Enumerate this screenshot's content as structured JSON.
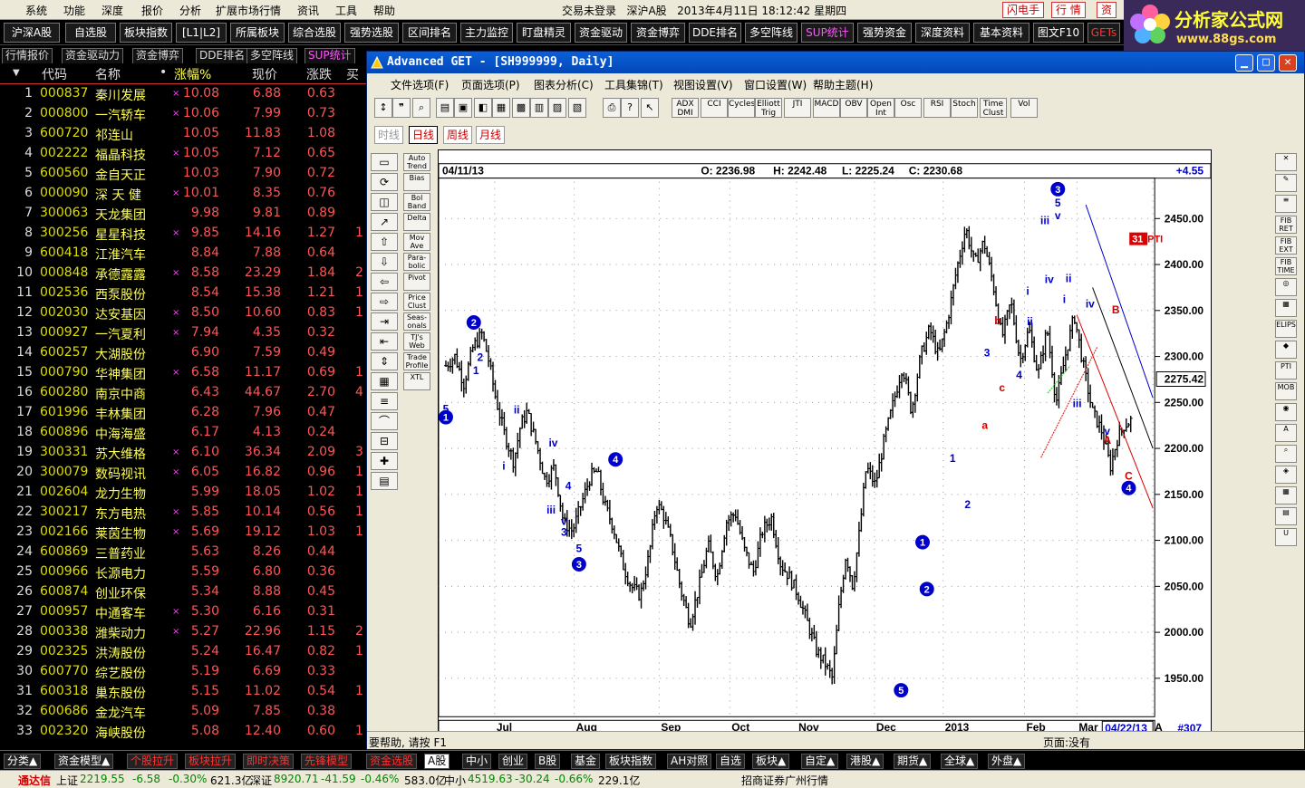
{
  "menu": [
    "系统",
    "功能",
    "深度",
    "报价",
    "分析",
    "扩展市场行情",
    "资讯",
    "工具",
    "帮助"
  ],
  "topstatus": {
    "login": "交易未登录",
    "market": "深沪A股",
    "datetime": "2013年4月11日 18:12:42 星期四"
  },
  "topbuttons": [
    "闪电手",
    "行 情",
    "资"
  ],
  "logo": {
    "title": "分析家公式网",
    "url": "www.88gs.com"
  },
  "toolbar2": [
    "沪深A股",
    "自选股",
    "板块指数",
    "[L1|L2]",
    "所属板块",
    "综合选股",
    "强势选股",
    "区间排名",
    "主力监控",
    "盯盘精灵",
    "资金驱动",
    "资金博弈",
    "DDE排名",
    "多空阵线",
    "SUP统计",
    "强势资金",
    "深度资料",
    "基本资料",
    "图文F10",
    "GETs"
  ],
  "tabs3": [
    "行情报价",
    "资金驱动力",
    "资金博弈",
    "DDE排名",
    "多空阵线",
    "SUP统计"
  ],
  "list": {
    "headers": [
      "代码",
      "名称",
      "•",
      "涨幅%",
      "现价",
      "涨跌",
      "买"
    ],
    "rows": [
      [
        "1",
        "000837",
        "秦川发展",
        "×",
        "10.08",
        "6.88",
        "0.63",
        ""
      ],
      [
        "2",
        "000800",
        "一汽轿车",
        "×",
        "10.06",
        "7.99",
        "0.73",
        ""
      ],
      [
        "3",
        "600720",
        "祁连山",
        "",
        "10.05",
        "11.83",
        "1.08",
        ""
      ],
      [
        "4",
        "002222",
        "福晶科技",
        "×",
        "10.05",
        "7.12",
        "0.65",
        ""
      ],
      [
        "5",
        "600560",
        "金自天正",
        "",
        "10.03",
        "7.90",
        "0.72",
        ""
      ],
      [
        "6",
        "000090",
        "深 天 健",
        "×",
        "10.01",
        "8.35",
        "0.76",
        ""
      ],
      [
        "7",
        "300063",
        "天龙集团",
        "",
        "9.98",
        "9.81",
        "0.89",
        ""
      ],
      [
        "8",
        "300256",
        "星星科技",
        "×",
        "9.85",
        "14.16",
        "1.27",
        "1"
      ],
      [
        "9",
        "600418",
        "江淮汽车",
        "",
        "8.84",
        "7.88",
        "0.64",
        ""
      ],
      [
        "10",
        "000848",
        "承德露露",
        "×",
        "8.58",
        "23.29",
        "1.84",
        "2"
      ],
      [
        "11",
        "002536",
        "西泵股份",
        "",
        "8.54",
        "15.38",
        "1.21",
        "1"
      ],
      [
        "12",
        "002030",
        "达安基因",
        "×",
        "8.50",
        "10.60",
        "0.83",
        "1"
      ],
      [
        "13",
        "000927",
        "一汽夏利",
        "×",
        "7.94",
        "4.35",
        "0.32",
        ""
      ],
      [
        "14",
        "600257",
        "大湖股份",
        "",
        "6.90",
        "7.59",
        "0.49",
        ""
      ],
      [
        "15",
        "000790",
        "华神集团",
        "×",
        "6.58",
        "11.17",
        "0.69",
        "1"
      ],
      [
        "16",
        "600280",
        "南京中商",
        "",
        "6.43",
        "44.67",
        "2.70",
        "4"
      ],
      [
        "17",
        "601996",
        "丰林集团",
        "",
        "6.28",
        "7.96",
        "0.47",
        ""
      ],
      [
        "18",
        "600896",
        "中海海盛",
        "",
        "6.17",
        "4.13",
        "0.24",
        ""
      ],
      [
        "19",
        "300331",
        "苏大维格",
        "×",
        "6.10",
        "36.34",
        "2.09",
        "3"
      ],
      [
        "20",
        "300079",
        "数码视讯",
        "×",
        "6.05",
        "16.82",
        "0.96",
        "1"
      ],
      [
        "21",
        "002604",
        "龙力生物",
        "",
        "5.99",
        "18.05",
        "1.02",
        "1"
      ],
      [
        "22",
        "300217",
        "东方电热",
        "×",
        "5.85",
        "10.14",
        "0.56",
        "1"
      ],
      [
        "23",
        "002166",
        "莱茵生物",
        "×",
        "5.69",
        "19.12",
        "1.03",
        "1"
      ],
      [
        "24",
        "600869",
        "三普药业",
        "",
        "5.63",
        "8.26",
        "0.44",
        ""
      ],
      [
        "25",
        "000966",
        "长源电力",
        "",
        "5.59",
        "6.80",
        "0.36",
        ""
      ],
      [
        "26",
        "600874",
        "创业环保",
        "",
        "5.34",
        "8.88",
        "0.45",
        ""
      ],
      [
        "27",
        "000957",
        "中通客车",
        "×",
        "5.30",
        "6.16",
        "0.31",
        ""
      ],
      [
        "28",
        "000338",
        "潍柴动力",
        "×",
        "5.27",
        "22.96",
        "1.15",
        "2"
      ],
      [
        "29",
        "002325",
        "洪涛股份",
        "",
        "5.24",
        "16.47",
        "0.82",
        "1"
      ],
      [
        "30",
        "600770",
        "综艺股份",
        "",
        "5.19",
        "6.69",
        "0.33",
        ""
      ],
      [
        "31",
        "600318",
        "巢东股份",
        "",
        "5.15",
        "11.02",
        "0.54",
        "1"
      ],
      [
        "32",
        "600686",
        "金龙汽车",
        "",
        "5.09",
        "7.85",
        "0.38",
        ""
      ],
      [
        "33",
        "002320",
        "海峡股份",
        "",
        "5.08",
        "12.40",
        "0.60",
        "1"
      ]
    ]
  },
  "window": {
    "title": "Advanced GET - [SH999999, Daily]",
    "menu": [
      "文件选项(F)",
      "页面选项(P)",
      "图表分析(C)",
      "工具集锦(T)",
      "视图设置(V)",
      "窗口设置(W)",
      "帮助主题(H)"
    ],
    "tools": [
      "ADX DMI",
      "CCI",
      "Cycles",
      "Elliott Trig",
      "JTI",
      "MACD",
      "OBV",
      "Open Int",
      "Osc",
      "RSI",
      "Stoch",
      "Time Clust",
      "Vol"
    ],
    "periods": [
      "时线",
      "日线",
      "周线",
      "月线"
    ],
    "lefttools_b": [
      "Auto Trend",
      "Bias",
      "Bol Band",
      "Delta",
      "Mov Ave",
      "Para-bolic",
      "Pivot",
      "Price Clust",
      "Seas-onals",
      "TJ's Web",
      "Trade Profile",
      "XTL"
    ],
    "lefttools_a": [
      "RESET",
      "STUDY",
      "Elliott",
      "LINES",
      "GANN",
      "FIB"
    ],
    "righttools": [
      "FIB RET",
      "FIB EXT",
      "FIB TIME",
      "ELIPS",
      "PTI",
      "MOB"
    ],
    "status": {
      "help": "要帮助, 请按 F1",
      "page": "页面:没有"
    }
  },
  "chart_data": {
    "type": "ohlc",
    "date": "04/11/13",
    "ohlc_readout": {
      "O": "2236.98",
      "H": "2242.48",
      "L": "2225.24",
      "C": "2230.68"
    },
    "change": "+4.55",
    "last_price": "2275.42",
    "pti": "31",
    "pti_label": "PTI",
    "end_date": "04/22/13",
    "bar_count": "#307",
    "ylim": [
      1920,
      2490
    ],
    "yticks": [
      "2450.00",
      "2400.00",
      "2350.00",
      "2300.00",
      "2250.00",
      "2200.00",
      "2150.00",
      "2100.00",
      "2050.00",
      "2000.00",
      "1950.00"
    ],
    "xticks": [
      "Jul",
      "Aug",
      "Sep",
      "Oct",
      "Nov",
      "Dec",
      "2013",
      "Feb",
      "Mar",
      "A"
    ],
    "anchors": [
      [
        0,
        2290
      ],
      [
        4,
        2300
      ],
      [
        8,
        2270
      ],
      [
        12,
        2310
      ],
      [
        16,
        2325
      ],
      [
        19,
        2295
      ],
      [
        22,
        2255
      ],
      [
        26,
        2215
      ],
      [
        30,
        2185
      ],
      [
        33,
        2225
      ],
      [
        36,
        2240
      ],
      [
        40,
        2205
      ],
      [
        44,
        2165
      ],
      [
        48,
        2180
      ],
      [
        52,
        2120
      ],
      [
        56,
        2110
      ],
      [
        60,
        2140
      ],
      [
        64,
        2170
      ],
      [
        67,
        2175
      ],
      [
        70,
        2140
      ],
      [
        74,
        2115
      ],
      [
        78,
        2075
      ],
      [
        82,
        2050
      ],
      [
        86,
        2040
      ],
      [
        90,
        2085
      ],
      [
        93,
        2140
      ],
      [
        96,
        2130
      ],
      [
        100,
        2095
      ],
      [
        104,
        2045
      ],
      [
        108,
        2010
      ],
      [
        112,
        2050
      ],
      [
        116,
        2095
      ],
      [
        120,
        2060
      ],
      [
        124,
        2120
      ],
      [
        128,
        2130
      ],
      [
        132,
        2090
      ],
      [
        136,
        2065
      ],
      [
        140,
        2110
      ],
      [
        144,
        2125
      ],
      [
        148,
        2075
      ],
      [
        152,
        2060
      ],
      [
        156,
        2040
      ],
      [
        160,
        2010
      ],
      [
        164,
        1980
      ],
      [
        168,
        1965
      ],
      [
        171,
        1950
      ],
      [
        174,
        2030
      ],
      [
        177,
        2085
      ],
      [
        180,
        2050
      ],
      [
        183,
        2110
      ],
      [
        186,
        2180
      ],
      [
        190,
        2160
      ],
      [
        194,
        2210
      ],
      [
        198,
        2250
      ],
      [
        202,
        2290
      ],
      [
        206,
        2240
      ],
      [
        210,
        2300
      ],
      [
        214,
        2330
      ],
      [
        218,
        2300
      ],
      [
        222,
        2340
      ],
      [
        226,
        2395
      ],
      [
        230,
        2440
      ],
      [
        234,
        2400
      ],
      [
        238,
        2425
      ],
      [
        242,
        2380
      ],
      [
        246,
        2320
      ],
      [
        250,
        2360
      ],
      [
        254,
        2295
      ],
      [
        258,
        2330
      ],
      [
        262,
        2280
      ],
      [
        266,
        2330
      ],
      [
        270,
        2250
      ],
      [
        274,
        2300
      ],
      [
        278,
        2345
      ],
      [
        282,
        2290
      ],
      [
        286,
        2240
      ],
      [
        290,
        2220
      ],
      [
        294,
        2180
      ],
      [
        297,
        2210
      ],
      [
        300,
        2225
      ],
      [
        304,
        2232
      ]
    ],
    "waves": [
      {
        "t": "5",
        "i": 0,
        "p": 2243,
        "c": "#00c"
      },
      {
        "t": "1",
        "i": 0,
        "p": 2234,
        "c": "#00c",
        "circle": true
      },
      {
        "t": "2",
        "i": 13,
        "p": 2337,
        "c": "#00c",
        "circle": true
      },
      {
        "t": "2",
        "i": 16,
        "p": 2299,
        "c": "#00c"
      },
      {
        "t": "1",
        "i": 14,
        "p": 2285,
        "c": "#00c"
      },
      {
        "t": "ii",
        "i": 33,
        "p": 2242,
        "c": "#00c"
      },
      {
        "t": "i",
        "i": 27,
        "p": 2181,
        "c": "#00c"
      },
      {
        "t": "iv",
        "i": 50,
        "p": 2206,
        "c": "#00c"
      },
      {
        "t": "4",
        "i": 57,
        "p": 2159,
        "c": "#00c"
      },
      {
        "t": "iii",
        "i": 49,
        "p": 2133,
        "c": "#00c"
      },
      {
        "t": "v",
        "i": 55,
        "p": 2121,
        "c": "#00c"
      },
      {
        "t": "3",
        "i": 55,
        "p": 2109,
        "c": "#00c"
      },
      {
        "t": "5",
        "i": 62,
        "p": 2091,
        "c": "#00c"
      },
      {
        "t": "3",
        "i": 62,
        "p": 2074,
        "c": "#00c",
        "circle": true
      },
      {
        "t": "4",
        "i": 79,
        "p": 2188,
        "c": "#00c",
        "circle": true
      },
      {
        "t": "5",
        "i": 212,
        "p": 1937,
        "c": "#00c",
        "circle": true
      },
      {
        "t": "1",
        "i": 222,
        "p": 2098,
        "c": "#00c",
        "circle": true
      },
      {
        "t": "2",
        "i": 224,
        "p": 2047,
        "c": "#00c",
        "circle": true
      },
      {
        "t": "1",
        "i": 236,
        "p": 2189,
        "c": "#00c"
      },
      {
        "t": "2",
        "i": 243,
        "p": 2139,
        "c": "#00c"
      },
      {
        "t": "a",
        "i": 251,
        "p": 2225,
        "c": "#c00"
      },
      {
        "t": "3",
        "i": 252,
        "p": 2304,
        "c": "#00c"
      },
      {
        "t": "c",
        "i": 259,
        "p": 2266,
        "c": "#c00"
      },
      {
        "t": "b",
        "i": 257,
        "p": 2339,
        "c": "#c00"
      },
      {
        "t": "4",
        "i": 267,
        "p": 2280,
        "c": "#00c"
      },
      {
        "t": "i",
        "i": 271,
        "p": 2371,
        "c": "#00c"
      },
      {
        "t": "ii",
        "i": 272,
        "p": 2338,
        "c": "#00c"
      },
      {
        "t": "iii",
        "i": 279,
        "p": 2448,
        "c": "#00c"
      },
      {
        "t": "5",
        "i": 285,
        "p": 2467,
        "c": "#00c"
      },
      {
        "t": "3",
        "i": 285,
        "p": 2482,
        "c": "#00c",
        "circle": true
      },
      {
        "t": "v",
        "i": 285,
        "p": 2453,
        "c": "#00c"
      },
      {
        "t": "iv",
        "i": 281,
        "p": 2384,
        "c": "#00c"
      },
      {
        "t": "ii",
        "i": 290,
        "p": 2385,
        "c": "#00c"
      },
      {
        "t": "i",
        "i": 288,
        "p": 2362,
        "c": "#00c"
      },
      {
        "t": "iii",
        "i": 294,
        "p": 2249,
        "c": "#00c"
      },
      {
        "t": "iv",
        "i": 300,
        "p": 2357,
        "c": "#00c"
      },
      {
        "t": "v",
        "i": 308,
        "p": 2219,
        "c": "#00c"
      },
      {
        "t": "A",
        "i": 308,
        "p": 2209,
        "c": "#c00"
      },
      {
        "t": "B",
        "i": 312,
        "p": 2351,
        "c": "#c00"
      },
      {
        "t": "C",
        "i": 318,
        "p": 2170,
        "c": "#c00"
      },
      {
        "t": "4",
        "i": 318,
        "p": 2157,
        "c": "#00c",
        "circle": true
      }
    ]
  },
  "bottomtabs": [
    "分类▲",
    "资金模型▲",
    "个股拉升",
    "板块拉升",
    "即时决策",
    "先锋模型",
    "资金选股",
    "A股",
    "中小",
    "创业",
    "B股",
    "基金",
    "板块指数",
    "AH对照",
    "自选",
    "板块▲",
    "自定▲",
    "港股▲",
    "期货▲",
    "全球▲",
    "外盘▲"
  ],
  "statusbar": {
    "brand": "通达信",
    "sh_label": "上证",
    "sh": "2219.55",
    "sh_chg": "-6.58",
    "sh_pct": "-0.30%",
    "sh_amt": "621.3亿",
    "sz_label": "深证",
    "sz": "8920.71",
    "sz_chg": "-41.59",
    "sz_pct": "-0.46%",
    "sz_amt": "583.0亿",
    "zx_label": "中小",
    "zx": "4519.63",
    "zx_chg": "-30.24",
    "zx_pct": "-0.66%",
    "zx_amt": "229.1亿",
    "broker": "招商证券广州行情"
  }
}
